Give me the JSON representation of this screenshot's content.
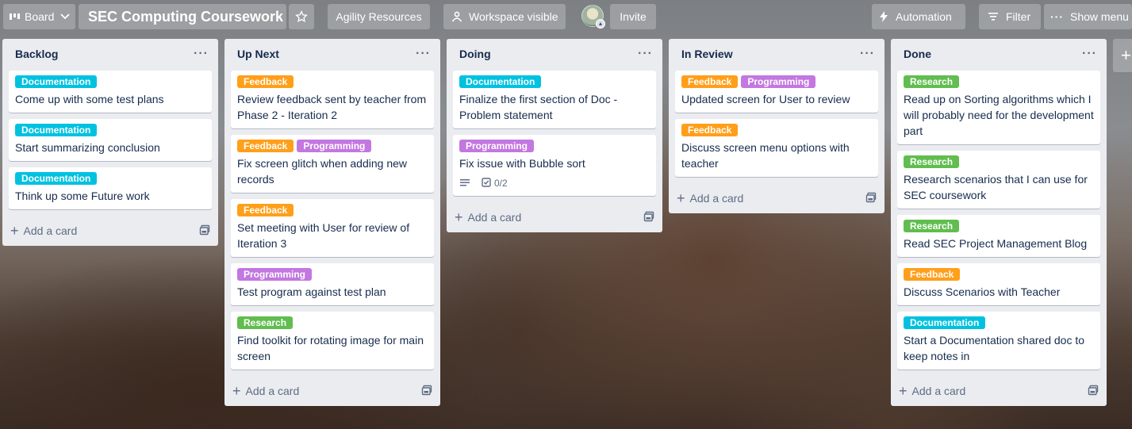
{
  "topbar": {
    "board_switcher": "Board",
    "board_title": "SEC Computing Coursework",
    "workspace": "Agility Resources",
    "visibility": "Workspace visible",
    "invite": "Invite",
    "automation": "Automation",
    "filter": "Filter",
    "show_menu": "Show menu"
  },
  "label_colors": {
    "Documentation": "#00c2e0",
    "Feedback": "#ff9f1a",
    "Programming": "#c377e0",
    "Research": "#61bd4f"
  },
  "lists": [
    {
      "title": "Backlog",
      "add_card": "Add a card",
      "cards": [
        {
          "labels": [
            "Documentation"
          ],
          "title": "Come up with some test plans"
        },
        {
          "labels": [
            "Documentation"
          ],
          "title": "Start summarizing conclusion"
        },
        {
          "labels": [
            "Documentation"
          ],
          "title": "Think up some Future work"
        }
      ]
    },
    {
      "title": "Up Next",
      "add_card": "Add a card",
      "cards": [
        {
          "labels": [
            "Feedback"
          ],
          "title": "Review feedback sent by teacher from Phase 2 - Iteration 2"
        },
        {
          "labels": [
            "Feedback",
            "Programming"
          ],
          "title": "Fix screen glitch when adding new records"
        },
        {
          "labels": [
            "Feedback"
          ],
          "title": "Set meeting with User for review of Iteration 3"
        },
        {
          "labels": [
            "Programming"
          ],
          "title": "Test program against test plan"
        },
        {
          "labels": [
            "Research"
          ],
          "title": "Find toolkit for rotating image for main screen"
        }
      ]
    },
    {
      "title": "Doing",
      "add_card": "Add a card",
      "cards": [
        {
          "labels": [
            "Documentation"
          ],
          "title": "Finalize the first section of Doc - Problem statement"
        },
        {
          "labels": [
            "Programming"
          ],
          "title": "Fix issue with Bubble sort",
          "has_description": true,
          "checklist": "0/2"
        }
      ]
    },
    {
      "title": "In Review",
      "add_card": "Add a card",
      "cards": [
        {
          "labels": [
            "Feedback",
            "Programming"
          ],
          "title": "Updated screen for User to review"
        },
        {
          "labels": [
            "Feedback"
          ],
          "title": "Discuss screen menu options with teacher"
        }
      ]
    },
    {
      "title": "Done",
      "add_card": "Add a card",
      "cards": [
        {
          "labels": [
            "Research"
          ],
          "title": "Read up on Sorting algorithms which I will probably need for the development part"
        },
        {
          "labels": [
            "Research"
          ],
          "title": "Research scenarios that I can use for SEC coursework"
        },
        {
          "labels": [
            "Research"
          ],
          "title": "Read SEC Project Management Blog"
        },
        {
          "labels": [
            "Feedback"
          ],
          "title": "Discuss Scenarios with Teacher"
        },
        {
          "labels": [
            "Documentation"
          ],
          "title": "Start a Documentation shared doc to keep notes in"
        }
      ]
    }
  ]
}
